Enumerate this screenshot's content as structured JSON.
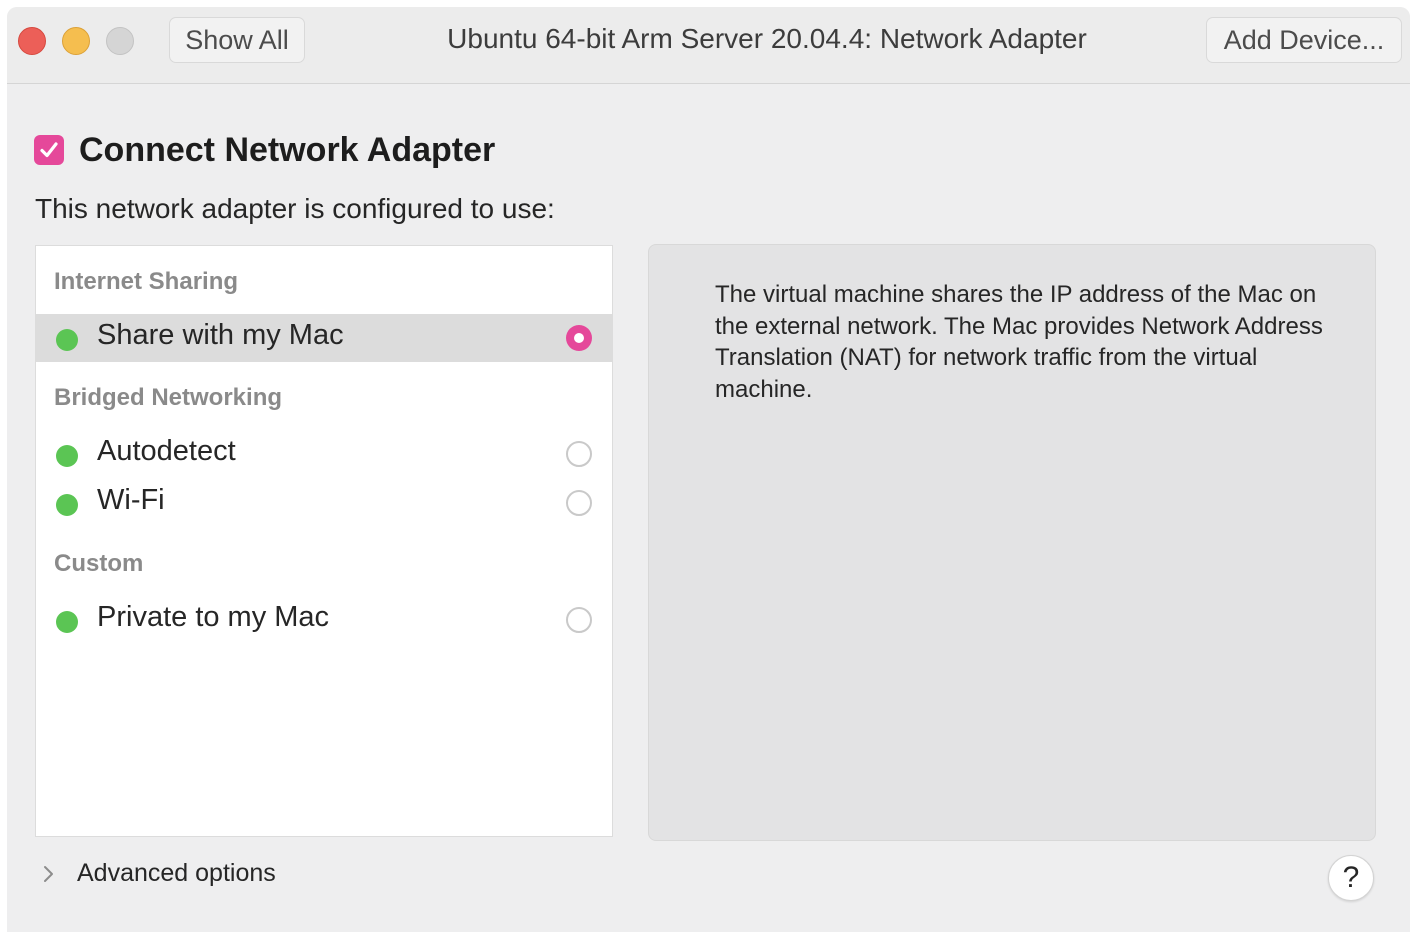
{
  "window": {
    "title": "Ubuntu 64-bit Arm Server 20.04.4: Network Adapter",
    "show_all_label": "Show All",
    "add_device_label": "Add Device..."
  },
  "connect": {
    "label": "Connect Network Adapter",
    "checked": true
  },
  "configured_label": "This network adapter is configured to use:",
  "groups": {
    "internet_sharing": {
      "header": "Internet Sharing",
      "items": [
        {
          "label": "Share with my Mac",
          "selected": true,
          "status": "green"
        }
      ]
    },
    "bridged": {
      "header": "Bridged Networking",
      "items": [
        {
          "label": "Autodetect",
          "selected": false,
          "status": "green"
        },
        {
          "label": "Wi-Fi",
          "selected": false,
          "status": "green"
        }
      ]
    },
    "custom": {
      "header": "Custom",
      "items": [
        {
          "label": "Private to my Mac",
          "selected": false,
          "status": "green"
        }
      ]
    }
  },
  "description": "The virtual machine shares the IP address of the Mac on the external network. The Mac provides Network Address Translation (NAT) for network traffic from the virtual machine.",
  "advanced_label": "Advanced options",
  "help_label": "?",
  "colors": {
    "accent": "#e5489a",
    "status_green": "#5bc554"
  },
  "icons": {
    "checkbox": "checkmark-icon",
    "status": "green-status-dot-icon",
    "disclosure": "chevron-right-icon",
    "help": "question-mark-icon"
  }
}
